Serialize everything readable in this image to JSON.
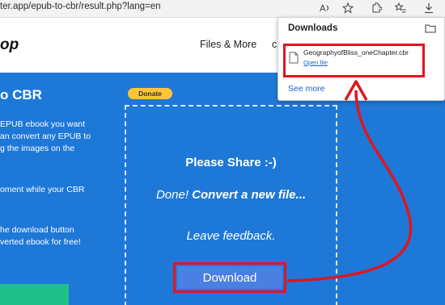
{
  "browser": {
    "url": "ter.app/epub-to-cbr/result.php?lang=en",
    "toolbar_icons": [
      "read-aloud-icon",
      "favorite-icon",
      "extensions-icon",
      "favorites-list-icon",
      "downloads-icon"
    ]
  },
  "site": {
    "logo_fragment": "op",
    "nav": {
      "files_more": "Files & More",
      "cut_item": "c"
    }
  },
  "sidebar": {
    "title": "o CBR",
    "lines": [
      "EPUB ebook you want",
      "an convert any EPUB to",
      "g the images on the",
      "oment while your CBR",
      "he download button",
      "verted ebook for free!"
    ]
  },
  "donate_label": "Donate",
  "result": {
    "share": "Please Share :-)",
    "done": "Done!",
    "convert_new": "Convert a new file...",
    "feedback": "Leave feedback.",
    "download_label": "Download"
  },
  "downloads_panel": {
    "title": "Downloads",
    "file_name": "GeographyofBliss_oneChapter.cbr",
    "open_file": "Open file",
    "see_more": "See more"
  },
  "colors": {
    "main_blue": "#1e78d7",
    "highlight_red": "#e0151f",
    "download_button": "#4a7fe3",
    "donate_yellow": "#ffc439",
    "link_blue": "#1a63c7"
  }
}
